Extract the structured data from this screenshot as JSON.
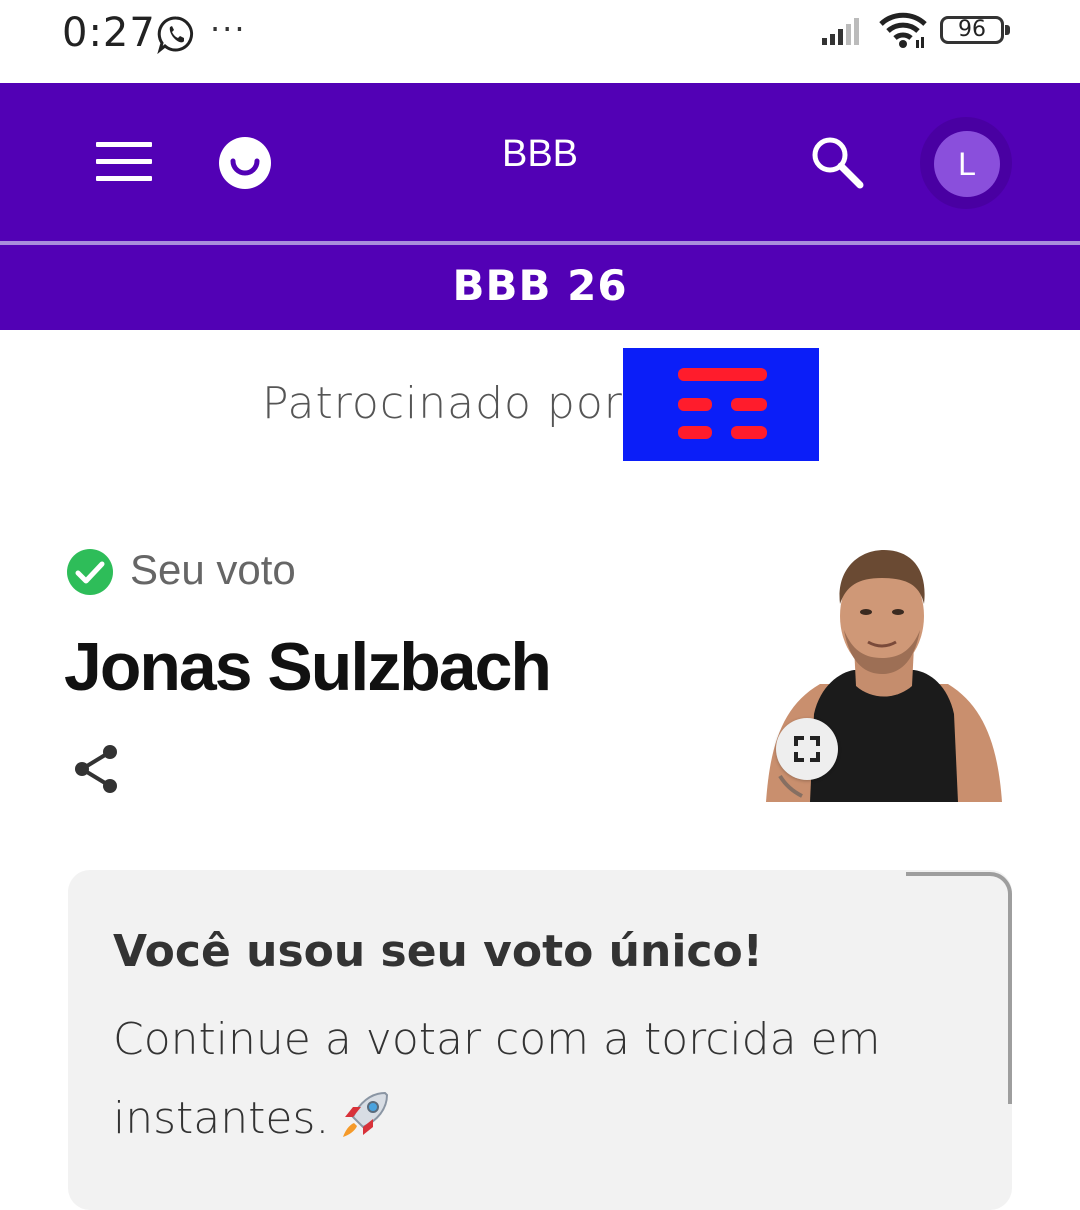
{
  "status_bar": {
    "time": "0:27",
    "notification_dots": "···",
    "battery": "96",
    "icons": [
      "whatsapp-icon",
      "signal-icon",
      "wifi-icon",
      "battery-icon"
    ]
  },
  "header": {
    "title": "BBB",
    "avatar_initial": "L",
    "subtitle": "BBB 26",
    "colors": {
      "primary": "#5201b5",
      "avatar": "#8a4fdc"
    }
  },
  "sponsor": {
    "label": "Patrocinado por",
    "colors": {
      "logo_bg": "#0b1ef8",
      "logo_stripes": "#ff1c2c"
    }
  },
  "vote": {
    "status_label": "Seu voto",
    "candidate_name": "Jonas Sulzbach",
    "colors": {
      "check": "#2ebd59"
    }
  },
  "message": {
    "title": "Você usou seu voto único!",
    "body": "Continue a votar com a torcida em instantes."
  }
}
